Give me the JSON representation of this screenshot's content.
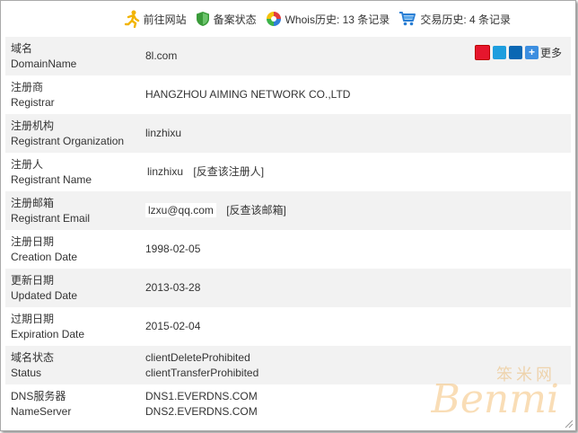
{
  "topbar": {
    "visit_site": "前往网站",
    "filing_status": "备案状态",
    "whois_history": "Whois历史: 13 条记录",
    "trade_history": "交易历史: 4 条记录"
  },
  "share": {
    "more": "更多"
  },
  "rows": [
    {
      "label_cn": "域名",
      "label_en": "DomainName",
      "value": "8l.com"
    },
    {
      "label_cn": "注册商",
      "label_en": "Registrar",
      "value": "HANGZHOU AIMING NETWORK CO.,LTD"
    },
    {
      "label_cn": "注册机构",
      "label_en": "Registrant Organization",
      "value": "linzhixu"
    },
    {
      "label_cn": "注册人",
      "label_en": "Registrant Name",
      "value": "linzhixu",
      "link": "[反查该注册人]"
    },
    {
      "label_cn": "注册邮箱",
      "label_en": "Registrant Email",
      "value": "lzxu@qq.com",
      "link": "[反查该邮箱]"
    },
    {
      "label_cn": "注册日期",
      "label_en": "Creation Date",
      "value": "1998-02-05"
    },
    {
      "label_cn": "更新日期",
      "label_en": "Updated Date",
      "value": "2013-03-28"
    },
    {
      "label_cn": "过期日期",
      "label_en": "Expiration Date",
      "value": "2015-02-04"
    },
    {
      "label_cn": "域名状态",
      "label_en": "Status",
      "value": "clientDeleteProhibited",
      "value2": "clientTransferProhibited"
    },
    {
      "label_cn": "DNS服务器",
      "label_en": "NameServer",
      "value": "DNS1.EVERDNS.COM",
      "value2": "DNS2.EVERDNS.COM"
    }
  ],
  "watermark": {
    "cn": "笨米网",
    "en": "Benmi"
  },
  "colors": {
    "row_alt": "#f2f2f2",
    "text": "#333333",
    "watermark": "#f0a030"
  }
}
